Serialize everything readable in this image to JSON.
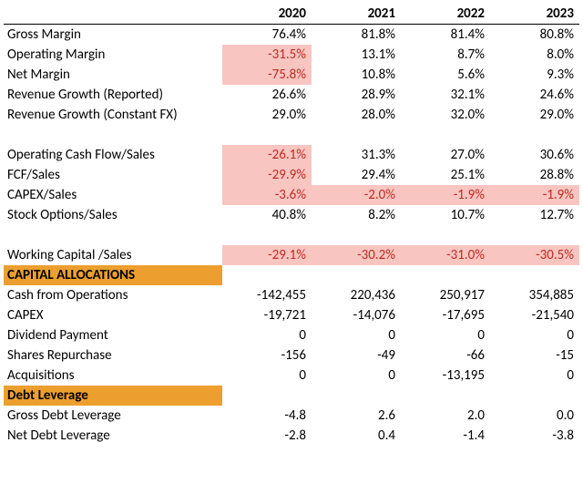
{
  "chart_data": {
    "type": "table",
    "columns": [
      "",
      "2020",
      "2021",
      "2022",
      "2023"
    ],
    "rows": [
      {
        "label": "Gross Margin",
        "values": [
          "76.4%",
          "81.8%",
          "81.4%",
          "80.8%"
        ],
        "neg": [
          false,
          false,
          false,
          false
        ]
      },
      {
        "label": "Operating Margin",
        "values": [
          "-31.5%",
          "13.1%",
          "8.7%",
          "8.0%"
        ],
        "neg": [
          true,
          false,
          false,
          false
        ]
      },
      {
        "label": "Net Margin",
        "values": [
          "-75.8%",
          "10.8%",
          "5.6%",
          "9.3%"
        ],
        "neg": [
          true,
          false,
          false,
          false
        ]
      },
      {
        "label": "Revenue Growth (Reported)",
        "values": [
          "26.6%",
          "28.9%",
          "32.1%",
          "24.6%"
        ],
        "neg": [
          false,
          false,
          false,
          false
        ]
      },
      {
        "label": "Revenue Growth (Constant FX)",
        "values": [
          "29.0%",
          "28.0%",
          "32.0%",
          "29.0%"
        ],
        "neg": [
          false,
          false,
          false,
          false
        ]
      },
      {
        "spacer": true
      },
      {
        "label": "Operating Cash Flow/Sales",
        "values": [
          "-26.1%",
          "31.3%",
          "27.0%",
          "30.6%"
        ],
        "neg": [
          true,
          false,
          false,
          false
        ]
      },
      {
        "label": "FCF/Sales",
        "values": [
          "-29.9%",
          "29.4%",
          "25.1%",
          "28.8%"
        ],
        "neg": [
          true,
          false,
          false,
          false
        ]
      },
      {
        "label": "CAPEX/Sales",
        "values": [
          "-3.6%",
          "-2.0%",
          "-1.9%",
          "-1.9%"
        ],
        "neg": [
          true,
          true,
          true,
          true
        ]
      },
      {
        "label": "Stock Options/Sales",
        "values": [
          "40.8%",
          "8.2%",
          "10.7%",
          "12.7%"
        ],
        "neg": [
          false,
          false,
          false,
          false
        ]
      },
      {
        "spacer": true
      },
      {
        "label": "Working Capital /Sales",
        "values": [
          "-29.1%",
          "-30.2%",
          "-31.0%",
          "-30.5%"
        ],
        "neg": [
          true,
          true,
          true,
          true
        ]
      },
      {
        "section": "CAPITAL ALLOCATIONS"
      },
      {
        "label": "Cash from Operations",
        "values": [
          "-142,455",
          "220,436",
          "250,917",
          "354,885"
        ],
        "neg": [
          false,
          false,
          false,
          false
        ]
      },
      {
        "label": "CAPEX",
        "values": [
          "-19,721",
          "-14,076",
          "-17,695",
          "-21,540"
        ],
        "neg": [
          false,
          false,
          false,
          false
        ]
      },
      {
        "label": "Dividend Payment",
        "values": [
          "0",
          "0",
          "0",
          "0"
        ],
        "neg": [
          false,
          false,
          false,
          false
        ]
      },
      {
        "label": "Shares Repurchase",
        "values": [
          "-156",
          "-49",
          "-66",
          "-15"
        ],
        "neg": [
          false,
          false,
          false,
          false
        ]
      },
      {
        "label": "Acquisitions",
        "values": [
          "0",
          "0",
          "-13,195",
          "0"
        ],
        "neg": [
          false,
          false,
          false,
          false
        ]
      },
      {
        "section": "Debt Leverage"
      },
      {
        "label": "Gross Debt Leverage",
        "values": [
          "-4.8",
          "2.6",
          "2.0",
          "0.0"
        ],
        "neg": [
          false,
          false,
          false,
          false
        ]
      },
      {
        "label": "Net Debt Leverage",
        "values": [
          "-2.8",
          "0.4",
          "-1.4",
          "-3.8"
        ],
        "neg": [
          false,
          false,
          false,
          false
        ]
      }
    ]
  }
}
